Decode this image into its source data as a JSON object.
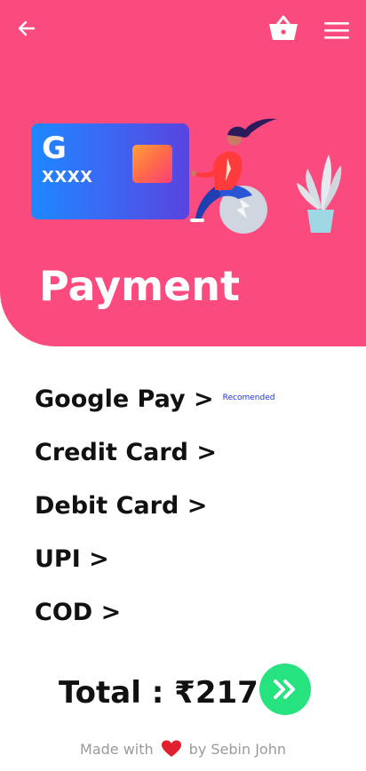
{
  "header": {
    "title": "Payment",
    "back_icon": "arrow-left-icon",
    "basket_icon": "basket-icon",
    "menu_icon": "hamburger-menu-icon",
    "background_color": "#fb4b7e"
  },
  "card": {
    "brand": "G",
    "number": "XXXX",
    "gradient_colors": [
      "#1e88ff",
      "#5a43e0"
    ],
    "chip_colors": [
      "#ffa23a",
      "#fb3e7a"
    ]
  },
  "payment_options": [
    {
      "label": "Google Pay >",
      "badge": "Recomended"
    },
    {
      "label": "Credit Card >"
    },
    {
      "label": "Debit Card >"
    },
    {
      "label": "UPI >"
    },
    {
      "label": "COD >"
    }
  ],
  "total": {
    "text": "Total : ₹217"
  },
  "next_button": {
    "icon": "double-chevron-right-icon",
    "color": "#26e27f"
  },
  "footer": {
    "made_with": "Made with",
    "by": "by Sebin John",
    "heart_icon": "heart-icon"
  }
}
